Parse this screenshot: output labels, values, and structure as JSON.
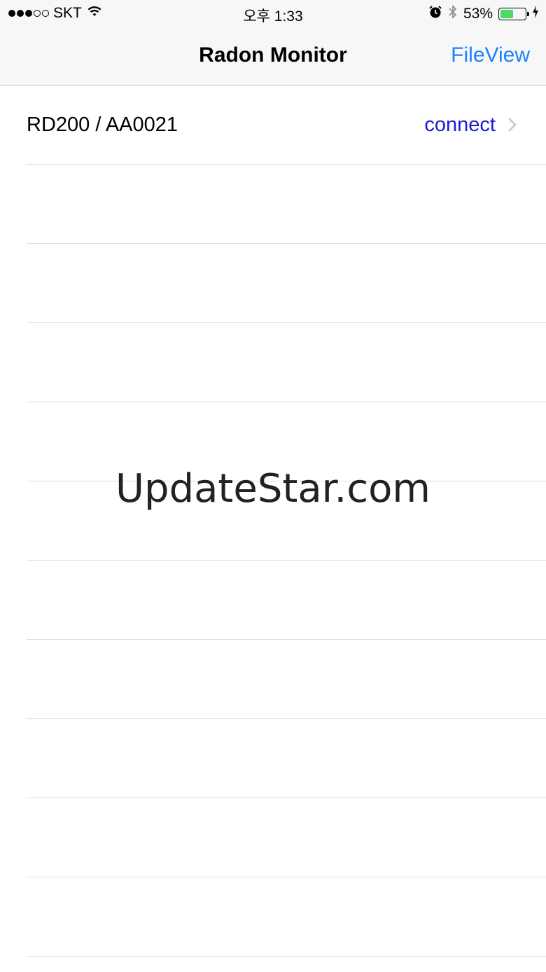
{
  "status_bar": {
    "carrier": "SKT",
    "time": "오후 1:33",
    "battery_percent": "53%",
    "battery_level": 0.53,
    "signal_bars_full": 3,
    "signal_bars_total": 5,
    "icons": [
      "wifi-icon",
      "alarm-icon",
      "bluetooth-icon",
      "battery-icon",
      "charging-icon"
    ]
  },
  "nav": {
    "title": "Radon Monitor",
    "right_button": "FileView"
  },
  "table": {
    "rows": [
      {
        "title": "RD200 / AA0021",
        "detail": "connect",
        "accessory": "chevron-right-icon"
      },
      {
        "title": "",
        "detail": ""
      },
      {
        "title": "",
        "detail": ""
      },
      {
        "title": "",
        "detail": ""
      },
      {
        "title": "",
        "detail": ""
      },
      {
        "title": "",
        "detail": ""
      },
      {
        "title": "",
        "detail": ""
      },
      {
        "title": "",
        "detail": ""
      },
      {
        "title": "",
        "detail": ""
      },
      {
        "title": "",
        "detail": ""
      },
      {
        "title": "",
        "detail": ""
      },
      {
        "title": "",
        "detail": ""
      }
    ]
  },
  "watermark": "UpdateStar.com",
  "colors": {
    "accent": "#1a82fb",
    "connect_text": "#1a1ad6",
    "battery_fill": "#4cd964",
    "bar_background": "#f7f7f7"
  }
}
